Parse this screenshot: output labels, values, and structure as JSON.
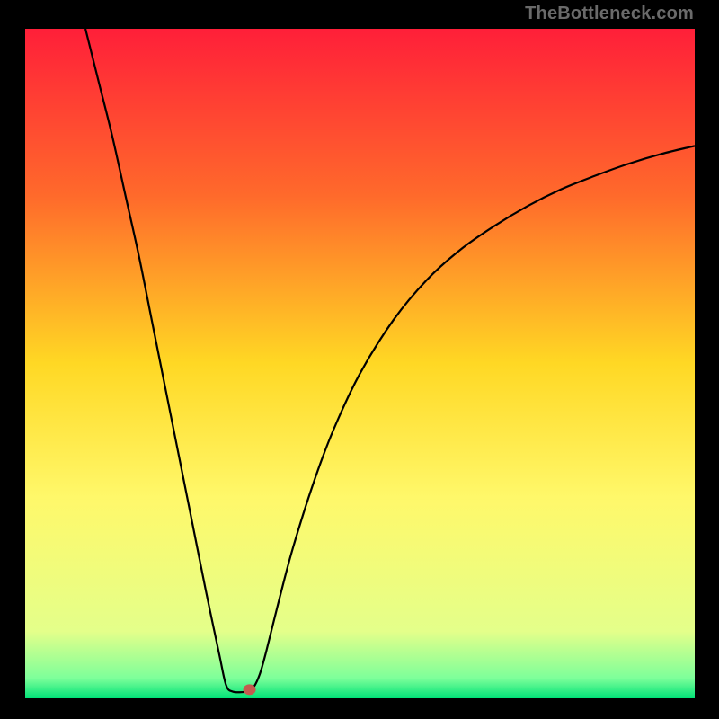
{
  "watermark": "TheBottleneck.com",
  "chart_data": {
    "type": "line",
    "title": "",
    "xlabel": "",
    "ylabel": "",
    "xlim": [
      0,
      100
    ],
    "ylim": [
      0,
      100
    ],
    "legend": false,
    "grid": false,
    "background_gradient": {
      "stops": [
        {
          "offset": 0.0,
          "color": "#ff1f39"
        },
        {
          "offset": 0.25,
          "color": "#ff6a2b"
        },
        {
          "offset": 0.5,
          "color": "#ffd824"
        },
        {
          "offset": 0.7,
          "color": "#fff86a"
        },
        {
          "offset": 0.9,
          "color": "#e4ff8a"
        },
        {
          "offset": 0.97,
          "color": "#7dff9a"
        },
        {
          "offset": 1.0,
          "color": "#00e277"
        }
      ]
    },
    "series": [
      {
        "name": "curve",
        "stroke": "#000000",
        "points": [
          {
            "x": 9.0,
            "y": 100.0
          },
          {
            "x": 11.0,
            "y": 92.0
          },
          {
            "x": 13.0,
            "y": 84.0
          },
          {
            "x": 15.0,
            "y": 75.0
          },
          {
            "x": 17.0,
            "y": 66.0
          },
          {
            "x": 19.0,
            "y": 56.0
          },
          {
            "x": 21.0,
            "y": 46.0
          },
          {
            "x": 23.0,
            "y": 36.0
          },
          {
            "x": 25.0,
            "y": 26.0
          },
          {
            "x": 27.0,
            "y": 16.0
          },
          {
            "x": 29.0,
            "y": 6.5
          },
          {
            "x": 30.0,
            "y": 2.0
          },
          {
            "x": 31.0,
            "y": 1.0
          },
          {
            "x": 33.0,
            "y": 1.0
          },
          {
            "x": 34.0,
            "y": 1.5
          },
          {
            "x": 35.0,
            "y": 3.5
          },
          {
            "x": 36.0,
            "y": 7.0
          },
          {
            "x": 38.0,
            "y": 15.0
          },
          {
            "x": 40.0,
            "y": 22.5
          },
          {
            "x": 43.0,
            "y": 32.0
          },
          {
            "x": 46.0,
            "y": 40.0
          },
          {
            "x": 50.0,
            "y": 48.5
          },
          {
            "x": 55.0,
            "y": 56.5
          },
          {
            "x": 60.0,
            "y": 62.5
          },
          {
            "x": 65.0,
            "y": 67.0
          },
          {
            "x": 70.0,
            "y": 70.5
          },
          {
            "x": 75.0,
            "y": 73.5
          },
          {
            "x": 80.0,
            "y": 76.0
          },
          {
            "x": 85.0,
            "y": 78.0
          },
          {
            "x": 90.0,
            "y": 79.8
          },
          {
            "x": 95.0,
            "y": 81.3
          },
          {
            "x": 100.0,
            "y": 82.5
          }
        ]
      }
    ],
    "marker": {
      "x": 33.5,
      "y": 1.3,
      "color": "#c45a4e",
      "rx": 7,
      "ry": 6
    }
  }
}
